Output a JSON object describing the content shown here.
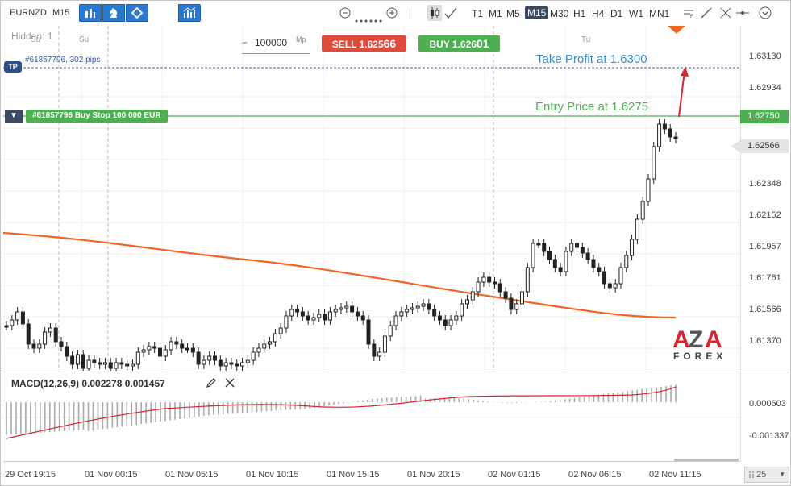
{
  "toolbar": {
    "symbol": "EURNZD",
    "timeframe_short": "M15",
    "timeframes": [
      "T1",
      "M1",
      "M5",
      "M15",
      "M30",
      "H1",
      "H4",
      "D1",
      "W1",
      "MN1"
    ],
    "active_timeframe": "M15"
  },
  "chart": {
    "hidden_label": "Hidden: 1",
    "day_labels": [
      "Su",
      "Tu"
    ],
    "quantity_minus": "−",
    "quantity": "100000",
    "quantity_unit": "Mp",
    "sell": {
      "label": "SELL",
      "price_main": "1.625",
      "price_big": "66"
    },
    "buy": {
      "label": "BUY",
      "price_main": "1.626",
      "price_big": "01"
    },
    "tp_badge": "TP",
    "tp_line_text": "#61857796, 302 pips",
    "order_arrow": "▼",
    "order_tag": "#61857796 Buy Stop 100 000 EUR",
    "annotation_tp": "Take Profit at 1.6300",
    "annotation_entry": "Entry Price at 1.6275",
    "price_labels": [
      "1.63130",
      "1.62934",
      "1.62348",
      "1.62152",
      "1.61957",
      "1.61761",
      "1.61566",
      "1.61370"
    ],
    "entry_price_tag": "1.62750",
    "current_price_tag": "1.62566",
    "logo": {
      "letters": "AZA",
      "sub": "FOREX"
    }
  },
  "macd": {
    "title": "MACD(12,26,9) 0.002278 0.001457",
    "price_labels": [
      "0.000603",
      "-0.001337"
    ]
  },
  "time_axis": {
    "labels": [
      "29 Oct 19:15",
      "01 Nov 00:15",
      "01 Nov 05:15",
      "01 Nov 10:15",
      "01 Nov 15:15",
      "01 Nov 20:15",
      "02 Nov 01:15",
      "02 Nov 06:15",
      "02 Nov 11:15"
    ]
  },
  "zoom": {
    "value": "25"
  },
  "colors": {
    "accent": "#2b78d0",
    "sell": "#e04a3a",
    "buy": "#4caf50",
    "ma_line": "#f26522",
    "tp_line": "#3a5c9a",
    "entry_line": "#4caf50",
    "macd_signal": "#d9232e"
  }
}
